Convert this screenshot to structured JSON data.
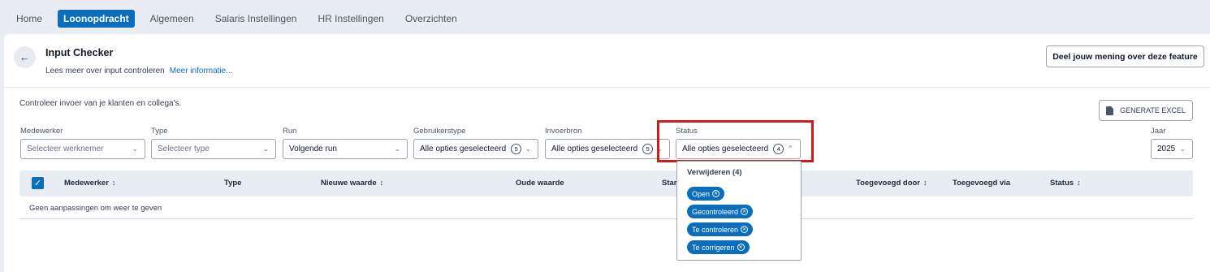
{
  "nav": {
    "items": [
      {
        "label": "Home",
        "active": false
      },
      {
        "label": "Loonopdracht",
        "active": true
      },
      {
        "label": "Algemeen",
        "active": false
      },
      {
        "label": "Salaris Instellingen",
        "active": false
      },
      {
        "label": "HR Instellingen",
        "active": false
      },
      {
        "label": "Overzichten",
        "active": false
      }
    ]
  },
  "header": {
    "title": "Input Checker",
    "subtitle": "Lees meer over input controleren",
    "more_link": "Meer informatie...",
    "feedback_button": "Deel jouw mening over deze feature",
    "back_icon": "arrow-left-icon"
  },
  "intro": "Controleer invoer van je klanten en collega's.",
  "excel_button": "GENERATE EXCEL",
  "filters": {
    "medewerker": {
      "label": "Medewerker",
      "placeholder": "Selecteer werknemer"
    },
    "type": {
      "label": "Type",
      "placeholder": "Selecteer type"
    },
    "run": {
      "label": "Run",
      "value": "Volgende run"
    },
    "gebruikerstype": {
      "label": "Gebruikerstype",
      "value": "Alle opties geselecteerd",
      "count": "5"
    },
    "invoerbron": {
      "label": "Invoerbron",
      "value": "Alle opties geselecteerd",
      "count": "5"
    },
    "status": {
      "label": "Status",
      "value": "Alle opties geselecteerd",
      "count": "4"
    },
    "jaar": {
      "label": "Jaar",
      "value": "2025"
    }
  },
  "table": {
    "columns": [
      "Medewerker",
      "Type",
      "Nieuwe waarde",
      "Oude waarde",
      "Star",
      "Toegevoegd door",
      "Toegevoegd via",
      "Status"
    ],
    "empty_text": "Geen aanpassingen om weer te geven"
  },
  "status_dropdown": {
    "remove_label": "Verwijderen (4)",
    "options": [
      "Open",
      "Gecontroleerd",
      "Te controleren",
      "Te corrigeren"
    ]
  },
  "colors": {
    "accent": "#0a6ebd",
    "highlight": "#c81e1e",
    "background": "#e9edf3"
  }
}
